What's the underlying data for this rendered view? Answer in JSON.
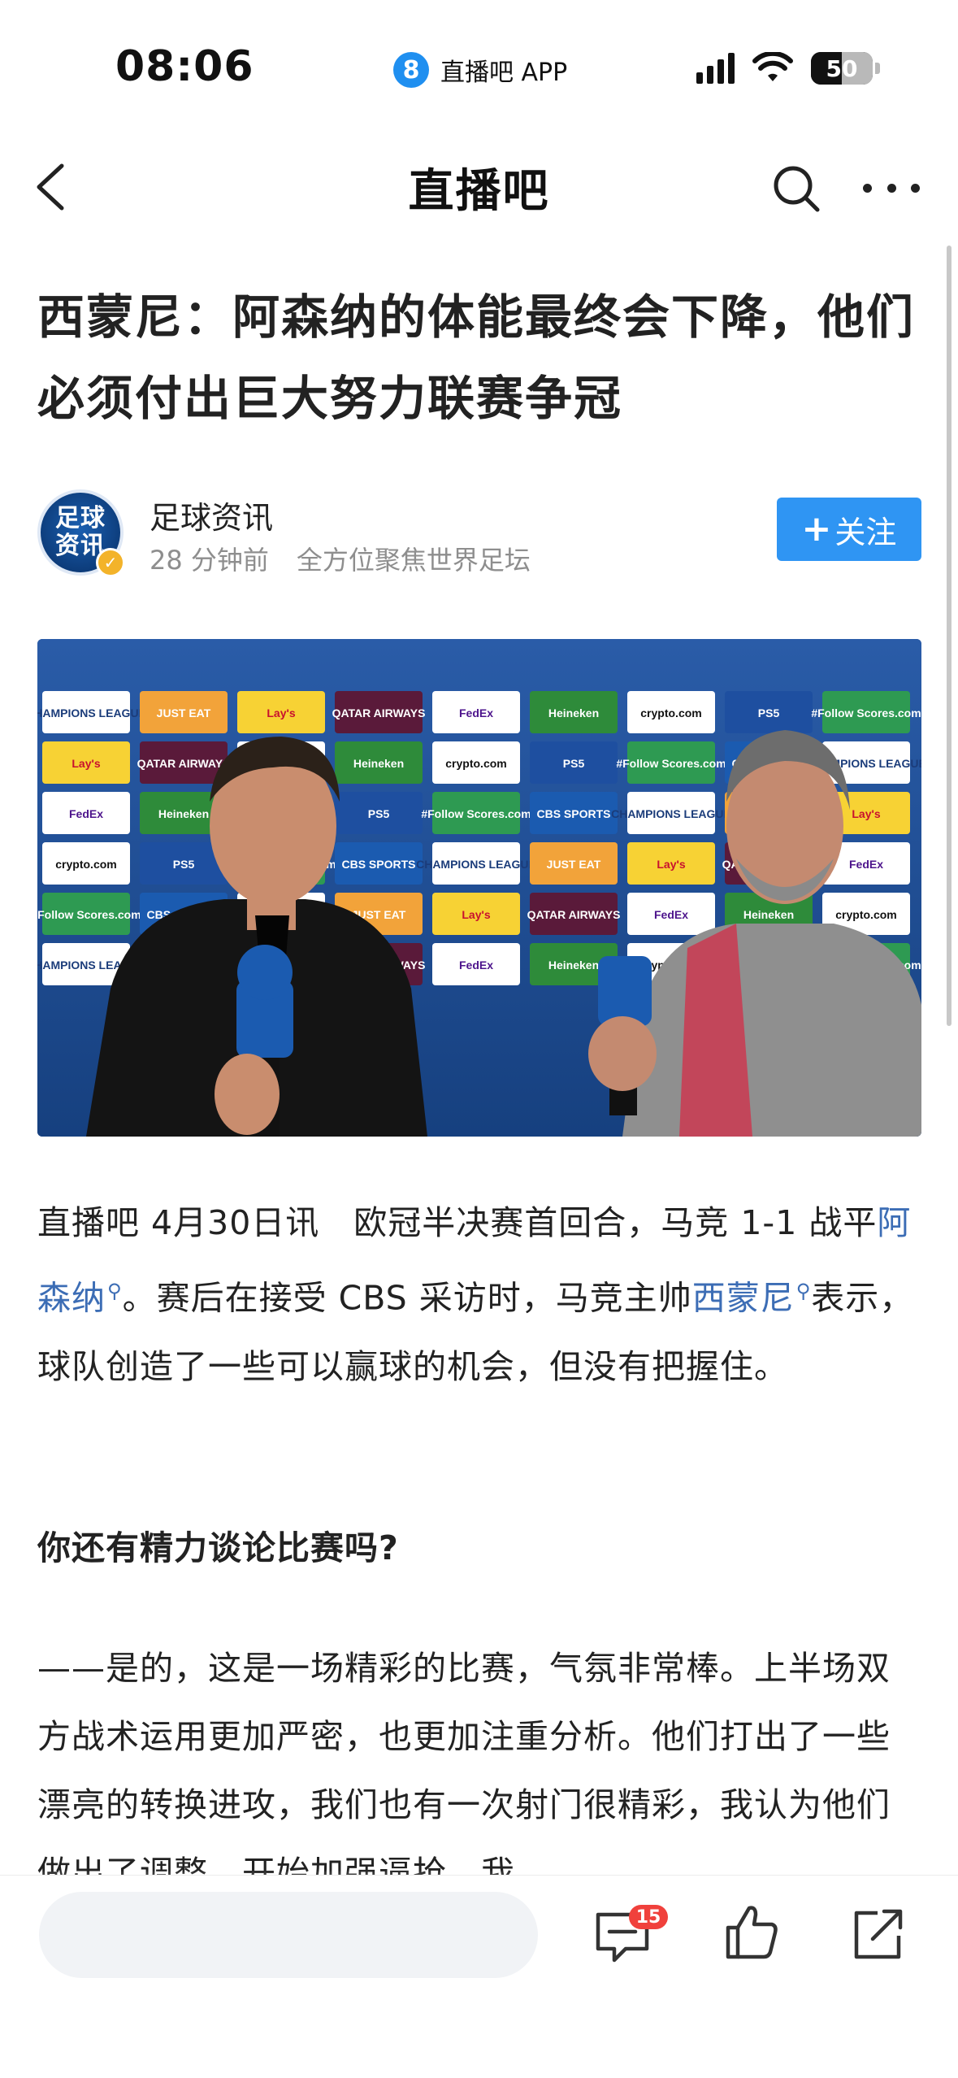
{
  "status_bar": {
    "time": "08:06",
    "app_badge": "8",
    "app_name": "直播吧 APP",
    "battery": "50",
    "battery_level": 0.5
  },
  "nav": {
    "title": "直播吧"
  },
  "article": {
    "title": "西蒙尼：阿森纳的体能最终会下降，他们必须付出巨大努力联赛争冠",
    "author": {
      "avatar_text": "足球\n资讯",
      "name": "足球资讯",
      "time": "28 分钟前",
      "tagline": "全方位聚焦世界足坛",
      "follow_label": "关注"
    },
    "image_sponsors": [
      "CHAMPIONS LEAGUE",
      "JUST EAT",
      "Lay's",
      "QATAR AIRWAYS",
      "FedEx",
      "Heineken",
      "crypto.com",
      "PS5",
      "#Follow Scores.com",
      "CBS SPORTS"
    ],
    "p1_a": "直播吧 4月30日讯　欧冠半决赛首回合，马竞 1-1 战平",
    "p1_link1": "阿森纳",
    "p1_b": "。赛后在接受 CBS 采访时，马竞主帅",
    "p1_link2": "西蒙尼",
    "p1_c": "表示，球队创造了一些可以赢球的机会，但没有把握住。",
    "q1": "你还有精力谈论比赛吗?",
    "p2": "——是的，这是一场精彩的比赛，气氛非常棒。上半场双方战术运用更加严密，也更加注重分析。他们打出了一些漂亮的转换进攻，我们也有一次射门很精彩，我认为他们做出了调整，开始加强逼抢，我"
  },
  "bottom_bar": {
    "comment_placeholder": "",
    "comment_count": "15"
  },
  "colors": {
    "accent": "#2f95f3",
    "link": "#3c6db5",
    "badge": "#f0413c"
  },
  "icons": [
    "back-icon",
    "search-icon",
    "more-icon",
    "comment-icon",
    "like-icon",
    "share-icon",
    "signal-icon",
    "wifi-icon",
    "battery-icon"
  ]
}
